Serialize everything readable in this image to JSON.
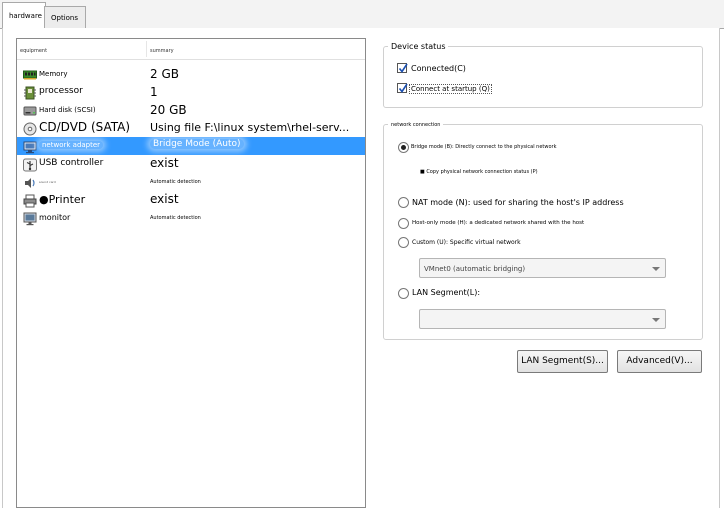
{
  "tabs": [
    {
      "label": "hardware",
      "active": true
    },
    {
      "label": "Options",
      "active": false
    }
  ],
  "device_list": {
    "columns": [
      "equipment",
      "summary"
    ],
    "rows": [
      {
        "icon": "memory-icon",
        "name": "Memory",
        "summary": "2 GB"
      },
      {
        "icon": "processor-icon",
        "name": "processor",
        "summary": "1"
      },
      {
        "icon": "hard-disk-icon",
        "name": "Hard disk (SCSI)",
        "summary": "20 GB"
      },
      {
        "icon": "cd-dvd-icon",
        "name": "CD/DVD (SATA)",
        "summary": "Using file F:\\linux system\\rhel-serv..."
      },
      {
        "icon": "network-adapter-icon",
        "name": "network adapter",
        "summary": "Bridge Mode (Auto)",
        "selected": true
      },
      {
        "icon": "usb-icon",
        "name": "USB controller",
        "summary": "exist"
      },
      {
        "icon": "sound-card-icon",
        "name": "sound card",
        "summary": "Automatic detection"
      },
      {
        "icon": "printer-icon",
        "name": "●Printer",
        "summary": "exist"
      },
      {
        "icon": "monitor-icon",
        "name": "monitor",
        "summary": "Automatic detection"
      }
    ]
  },
  "device_status": {
    "title": "Device status",
    "connected_label": "Connected(C)",
    "connected_checked": true,
    "startup_label": "Connect at startup (Q)",
    "startup_checked": true
  },
  "network_connection": {
    "title": "network connection",
    "bridge_label": "Bridge mode (B): Directly connect to the physical network",
    "copy_status_label": "■ Copy physical network connection status (P)",
    "nat_label": "NAT mode (N): used for sharing the host's IP address",
    "host_only_label": "Host-only mode (H): a dedicated network shared with the host",
    "custom_label": "Custom (U): Specific virtual network",
    "vmnet_value": "VMnet0 (automatic bridging)",
    "lan_segment_label": "LAN Segment(L):",
    "lan_segment_value": "",
    "selected_mode": "bridge"
  },
  "buttons": {
    "lan_segments": "LAN Segment(S)...",
    "advanced": "Advanced(V)..."
  },
  "colors": {
    "selection": "#3399ff",
    "check": "#1a4fb0"
  }
}
